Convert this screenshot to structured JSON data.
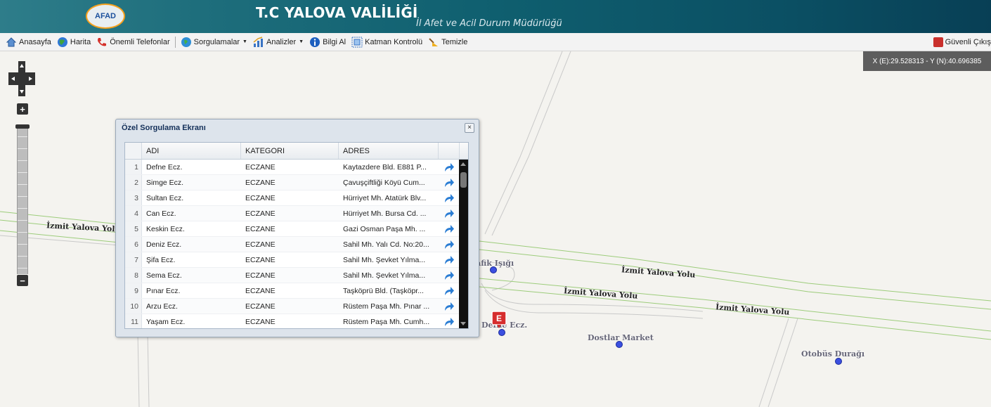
{
  "header": {
    "logo_text": "AFAD",
    "title": "T.C YALOVA VALİLİĞİ",
    "subtitle": "İl Afet ve Acil Durum Müdürlüğü"
  },
  "toolbar": {
    "items": [
      {
        "label": "Anasayfa",
        "icon": "home-icon"
      },
      {
        "label": "Harita",
        "icon": "globe-icon"
      },
      {
        "label": "Önemli Telefonlar",
        "icon": "phone-icon"
      },
      {
        "label": "Sorgulamalar",
        "icon": "search-globe-icon"
      },
      {
        "label": "Analizler",
        "icon": "chart-icon"
      },
      {
        "label": "Bilgi Al",
        "icon": "info-icon"
      },
      {
        "label": "Katman Kontrolü",
        "icon": "layers-icon"
      },
      {
        "label": "Temizle",
        "icon": "broom-icon"
      }
    ],
    "logout_label": "Güvenli Çıkış"
  },
  "coords": {
    "text": "X (E):29.528313 - Y (N):40.696385"
  },
  "map": {
    "road_labels": [
      "İzmit Yalova Yolu",
      "İzmit Yalova Yolu",
      "İzmit Yalova Yolu",
      "İzmit Yalova Yolu"
    ],
    "poi_labels": [
      "Trafik Işığı",
      "Defne Ecz.",
      "Dostlar Market",
      "Otobüs Durağı"
    ],
    "pin_letter": "E",
    "poi_color": "#3b4fe0",
    "pin_color": "#d62d2d"
  },
  "dialog": {
    "title": "Özel Sorgulama Ekranı",
    "close_label": "×",
    "columns": [
      "ADI",
      "KATEGORI",
      "ADRES"
    ],
    "rows": [
      {
        "n": "1",
        "adi": "Defne Ecz.",
        "kat": "ECZANE",
        "adr": "Kaytazdere Bld. E881 P..."
      },
      {
        "n": "2",
        "adi": "Simge Ecz.",
        "kat": "ECZANE",
        "adr": "Çavuşçiftliği Köyü Cum..."
      },
      {
        "n": "3",
        "adi": "Sultan Ecz.",
        "kat": "ECZANE",
        "adr": "Hürriyet Mh. Atatürk Blv..."
      },
      {
        "n": "4",
        "adi": "Can Ecz.",
        "kat": "ECZANE",
        "adr": "Hürriyet Mh. Bursa Cd. ..."
      },
      {
        "n": "5",
        "adi": "Keskin Ecz.",
        "kat": "ECZANE",
        "adr": "Gazi Osman Paşa Mh. ..."
      },
      {
        "n": "6",
        "adi": "Deniz Ecz.",
        "kat": "ECZANE",
        "adr": "Sahil Mh. Yalı Cd. No:20..."
      },
      {
        "n": "7",
        "adi": "Şifa Ecz.",
        "kat": "ECZANE",
        "adr": "Sahil Mh. Şevket Yılma..."
      },
      {
        "n": "8",
        "adi": "Sema Ecz.",
        "kat": "ECZANE",
        "adr": "Sahil Mh. Şevket Yılma..."
      },
      {
        "n": "9",
        "adi": "Pınar Ecz.",
        "kat": "ECZANE",
        "adr": "Taşköprü Bld. (Taşköpr..."
      },
      {
        "n": "10",
        "adi": "Arzu Ecz.",
        "kat": "ECZANE",
        "adr": "Rüstem Paşa Mh. Pınar ..."
      },
      {
        "n": "11",
        "adi": "Yaşam Ecz.",
        "kat": "ECZANE",
        "adr": "Rüstem Paşa Mh. Cumh..."
      }
    ]
  }
}
